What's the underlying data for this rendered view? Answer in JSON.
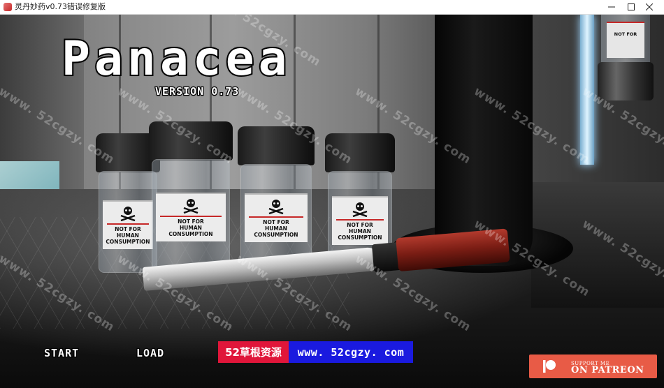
{
  "window": {
    "title": "灵丹妙药v0.73错误修复版",
    "minimize_label": "minimize",
    "maximize_label": "maximize",
    "close_label": "close"
  },
  "game": {
    "logo": "Panacea",
    "version": "VERSION 0.73"
  },
  "menu": {
    "start_label": "START",
    "load_label": "LOAD"
  },
  "banner": {
    "left_text": "52草根资源",
    "right_text": "www. 52cgzy. com"
  },
  "patreon": {
    "small_text": "SUPPORT ME",
    "big_text": "ON PATREON"
  },
  "vial_label": {
    "line1": "NOT FOR",
    "line2": "HUMAN",
    "line3": "CONSUMPTION"
  },
  "watermark": "www. 52cgzy. com",
  "colors": {
    "banner_red": "#e0163a",
    "banner_blue": "#1a1adf",
    "patreon": "#e85b46"
  }
}
